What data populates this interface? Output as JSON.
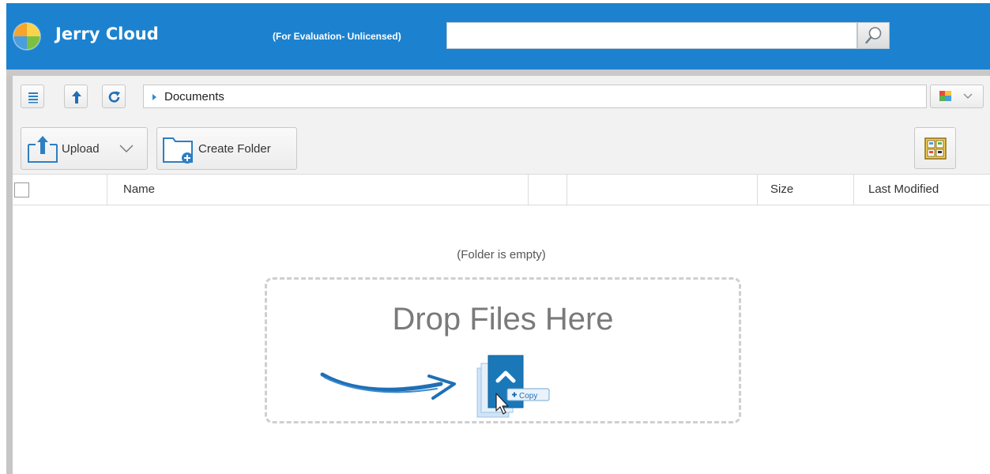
{
  "header": {
    "app_name": "Jerry Cloud",
    "license_note": "(For Evaluation- Unlicensed)",
    "search": {
      "value": "",
      "placeholder": ""
    },
    "brand_color": "#1c82cf"
  },
  "toolbar": {
    "buttons": [
      "menu-icon",
      "up-arrow-icon",
      "refresh-icon"
    ],
    "path": "Documents",
    "upload_label": "Upload",
    "create_folder_label": "Create Folder"
  },
  "table": {
    "columns": [
      "Name",
      "",
      "",
      "Size",
      "Last Modified"
    ]
  },
  "main": {
    "empty_message": "(Folder is empty)",
    "drop_title": "Drop Files Here",
    "copy_label": "Copy"
  }
}
